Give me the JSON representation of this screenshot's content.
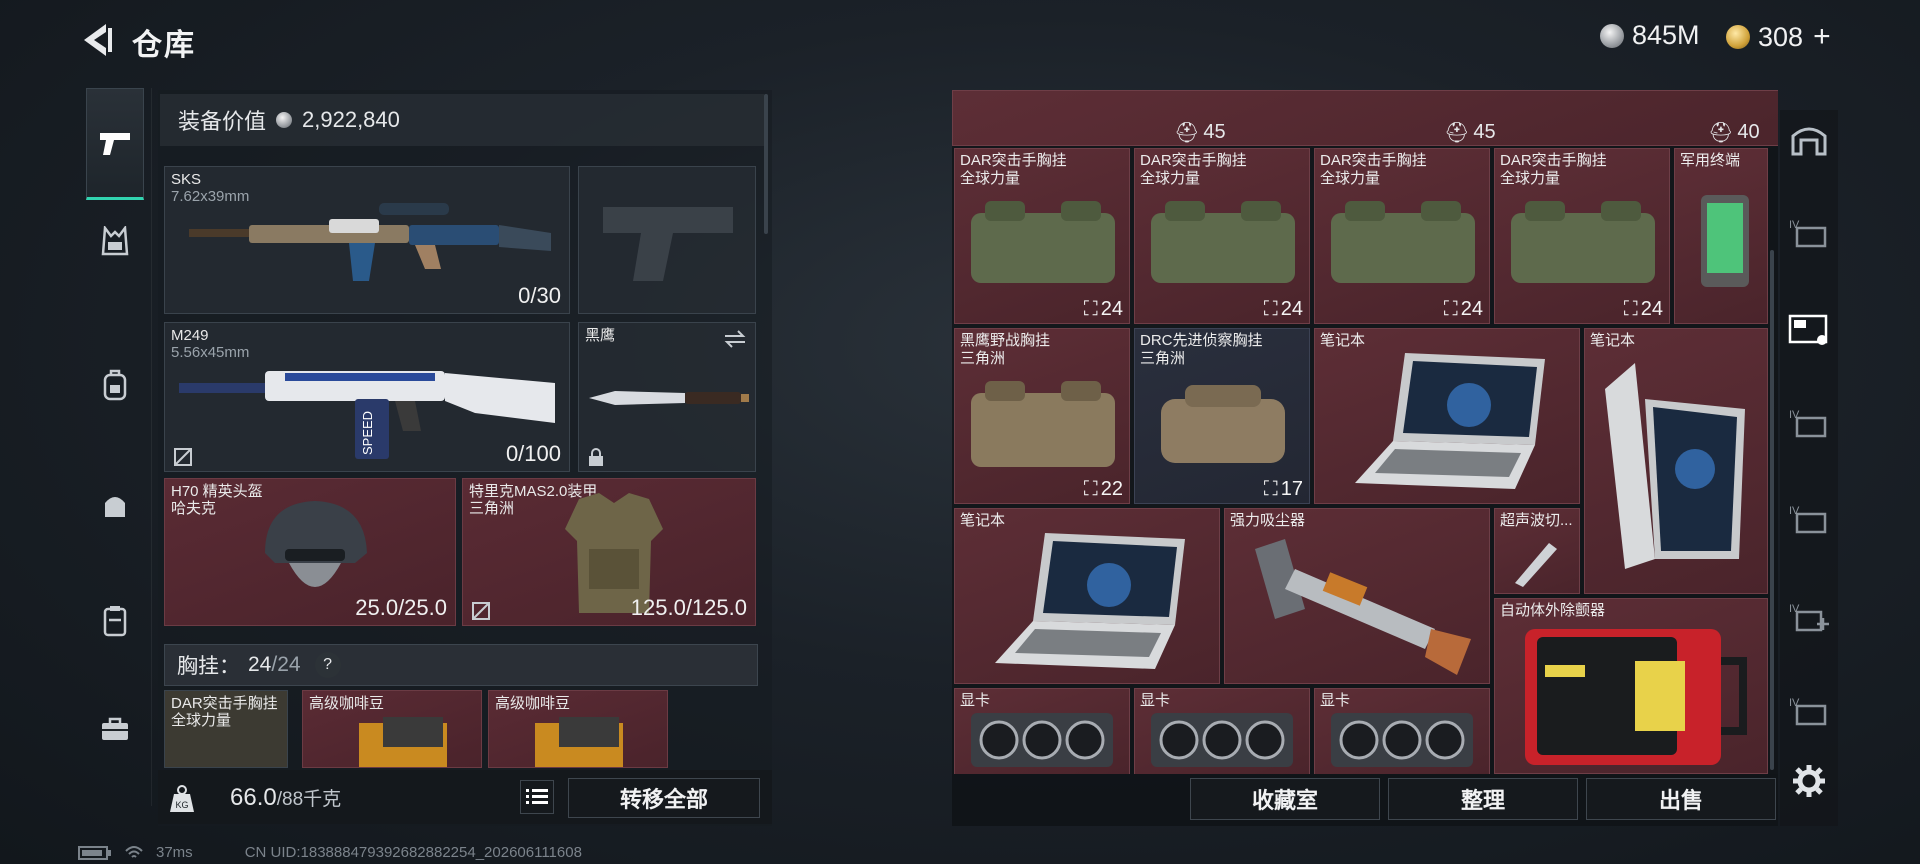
{
  "header": {
    "title": "仓库",
    "silver_amount": "845M",
    "gold_amount": "308"
  },
  "equipment": {
    "value_label": "装备价值",
    "value": "2,922,840",
    "primary": {
      "name": "SKS",
      "caliber": "7.62x39mm",
      "ammo": "0/30"
    },
    "secondary": {
      "name": "M249",
      "caliber": "5.56x45mm",
      "ammo": "0/100"
    },
    "melee": {
      "name": "黑鹰"
    },
    "helmet": {
      "name": "H70 精英头盔",
      "sub": "哈夫克",
      "durability": "25.0/25.0"
    },
    "armor": {
      "name": "特里克MAS2.0装甲",
      "sub": "三角洲",
      "durability": "125.0/125.0"
    },
    "rig_label": "胸挂：",
    "rig_used": "24",
    "rig_total": "/24",
    "rig_help": "?",
    "rig_items": [
      {
        "name": "DAR突击手胸挂",
        "sub": "全球力量"
      },
      {
        "name": "高级咖啡豆"
      },
      {
        "name": "高级咖啡豆"
      }
    ]
  },
  "bottom_left": {
    "weight": "66.0",
    "weight_max": "/88千克",
    "transfer_all": "转移全部"
  },
  "warehouse": {
    "top_counts": [
      "45",
      "45",
      "40"
    ],
    "rows": [
      [
        {
          "name": "DAR突击手胸挂",
          "sub": "全球力量",
          "count": "24"
        },
        {
          "name": "DAR突击手胸挂",
          "sub": "全球力量",
          "count": "24"
        },
        {
          "name": "DAR突击手胸挂",
          "sub": "全球力量",
          "count": "24"
        },
        {
          "name": "DAR突击手胸挂",
          "sub": "全球力量",
          "count": "24"
        },
        {
          "name": "军用终端"
        }
      ],
      [
        {
          "name": "黑鹰野战胸挂",
          "sub": "三角洲",
          "count": "22"
        },
        {
          "name": "DRC先进侦察胸挂",
          "sub": "三角洲",
          "count": "17"
        },
        {
          "name": "笔记本"
        },
        {
          "name": "笔记本"
        }
      ],
      [
        {
          "name": "笔记本"
        },
        {
          "name": "强力吸尘器"
        },
        {
          "name": "超声波切..."
        },
        {
          "name": "自动体外除颤器"
        }
      ],
      [
        {
          "name": "显卡"
        },
        {
          "name": "显卡"
        },
        {
          "name": "显卡"
        }
      ]
    ],
    "buttons": {
      "collection": "收藏室",
      "organize": "整理",
      "sell": "出售"
    }
  },
  "status": {
    "ping": "37ms",
    "uid": "CN UID:18388847939268288225­4_202606111608"
  },
  "icons": {
    "back": "back-arrow-icon",
    "pistol": "pistol-icon",
    "settings": "gear-icon"
  }
}
